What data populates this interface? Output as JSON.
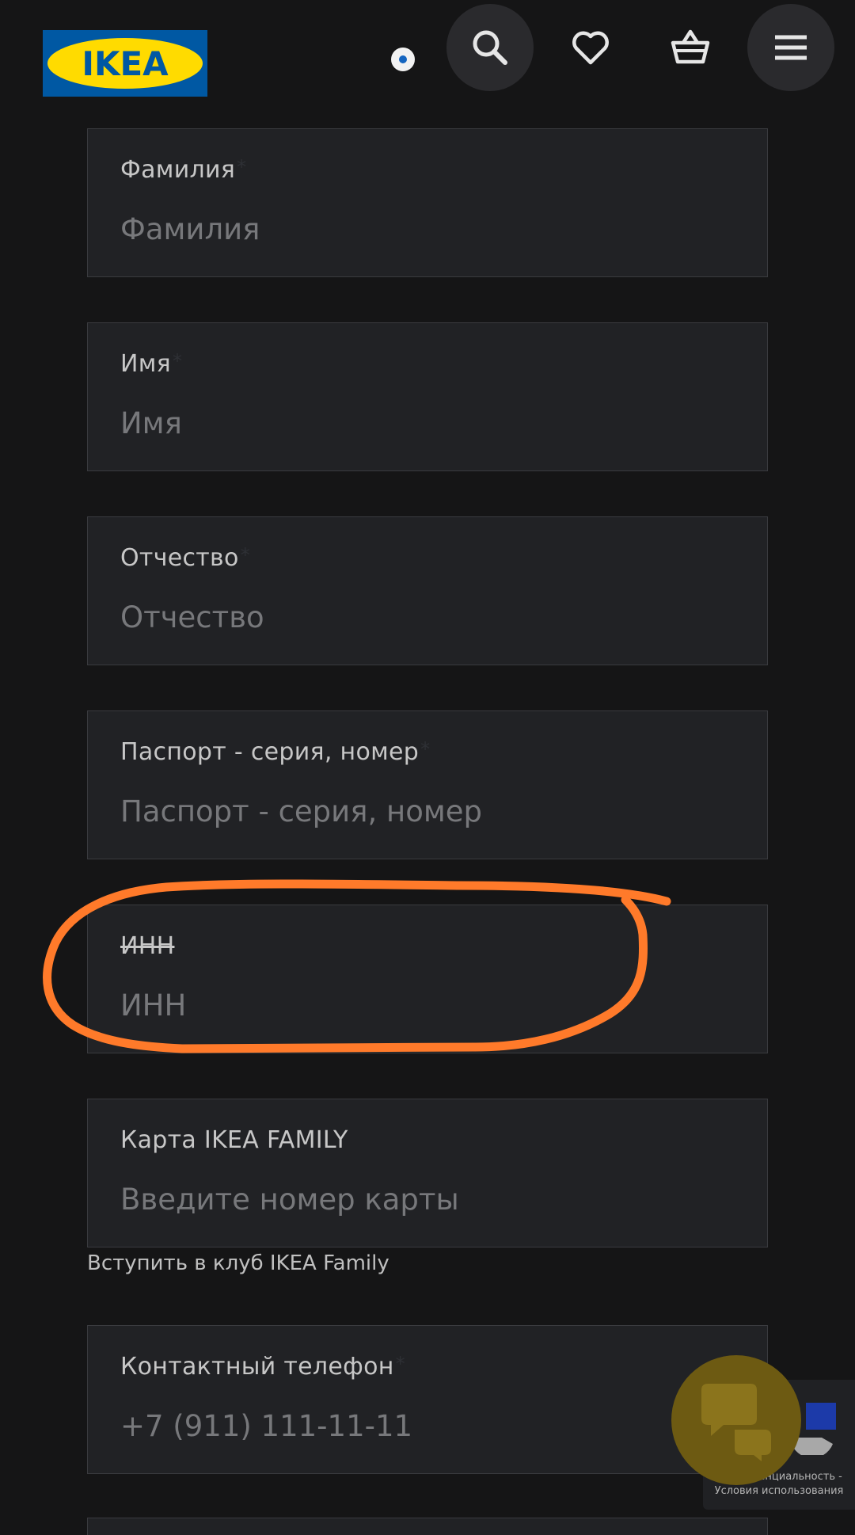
{
  "header": {
    "logo_text": "IKEA",
    "icons": {
      "search": "search-icon",
      "favorites": "heart-icon",
      "cart": "basket-icon",
      "menu": "hamburger-menu-icon"
    }
  },
  "form": {
    "last_name": {
      "label": "Фамилия",
      "placeholder": "Фамилия",
      "value": ""
    },
    "first_name": {
      "label": "Имя",
      "placeholder": "Имя",
      "value": ""
    },
    "patronymic": {
      "label": "Отчество",
      "placeholder": "Отчество",
      "value": ""
    },
    "passport": {
      "label": "Паспорт - серия, номер",
      "placeholder": "Паспорт - серия, номер",
      "value": ""
    },
    "inn": {
      "label": "ИНН",
      "placeholder": "ИНН",
      "value": ""
    },
    "family_card": {
      "label": "Карта IKEA FAMILY",
      "placeholder": "Введите номер карты",
      "value": ""
    },
    "join_link": "Вступить в клуб IKEA Family",
    "phone": {
      "label": "Контактный телефон",
      "placeholder": "+7 (911) 111-11-11",
      "value": ""
    },
    "required_mark": "*"
  },
  "recaptcha": {
    "privacy": "Конфиденциальность -",
    "terms": "Условия использования"
  },
  "colors": {
    "annotation": "#ff7a2a",
    "logo_blue": "#0058a3",
    "logo_yellow": "#ffdb00"
  }
}
